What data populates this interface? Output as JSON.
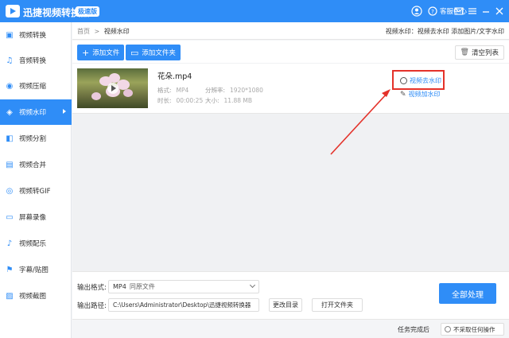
{
  "titlebar": {
    "app_title": "迅捷视频转换器",
    "badge": "极速版",
    "help": "客服中心",
    "icons": [
      "user-icon",
      "help-icon",
      "mail-icon",
      "menu-icon",
      "minimize-icon",
      "close-icon"
    ]
  },
  "sidebar": {
    "items": [
      {
        "label": "视频转换",
        "icon": "video-convert-icon"
      },
      {
        "label": "音频转换",
        "icon": "audio-convert-icon"
      },
      {
        "label": "视频压缩",
        "icon": "compress-icon"
      },
      {
        "label": "视频水印",
        "icon": "watermark-icon",
        "active": true
      },
      {
        "label": "视频分割",
        "icon": "split-icon"
      },
      {
        "label": "视频合并",
        "icon": "merge-icon"
      },
      {
        "label": "视频转GIF",
        "icon": "gif-icon"
      },
      {
        "label": "屏幕录像",
        "icon": "record-icon"
      },
      {
        "label": "视频配乐",
        "icon": "music-icon"
      },
      {
        "label": "字幕/贴图",
        "icon": "subtitle-icon"
      },
      {
        "label": "视频截图",
        "icon": "screenshot-icon"
      }
    ]
  },
  "topbar": {
    "crumb_home": "首页",
    "crumb_sep": ">",
    "crumb_current": "视频水印",
    "right_text": "视频水印：视频去水印 添加图片/文字水印"
  },
  "toolbar": {
    "add_file": "添加文件",
    "add_folder": "添加文件夹",
    "clear_list": "清空列表"
  },
  "file": {
    "name": "花朵.mp4",
    "format_label": "格式:",
    "format": "MP4",
    "resolution_label": "分辨率:",
    "resolution": "1920*1080",
    "duration_label": "时长:",
    "duration": "00:00:25",
    "size_label": "大小:",
    "size": "11.88 MB",
    "action_remove": "视频去水印",
    "action_add": "视频加水印"
  },
  "bottom": {
    "format_label": "输出格式:",
    "format_value": "MP4",
    "format_sub": "同原文件",
    "path_label": "输出路径:",
    "path_value": "C:\\Users\\Administrator\\Desktop\\迅捷视频转换器",
    "change_dir": "更改目录",
    "open_folder": "打开文件夹",
    "process_all": "全部处理"
  },
  "status": {
    "after_label": "任务完成后",
    "after_value": "不采取任何操作"
  },
  "colors": {
    "accent": "#2f8df7",
    "highlight": "#e4322a"
  }
}
